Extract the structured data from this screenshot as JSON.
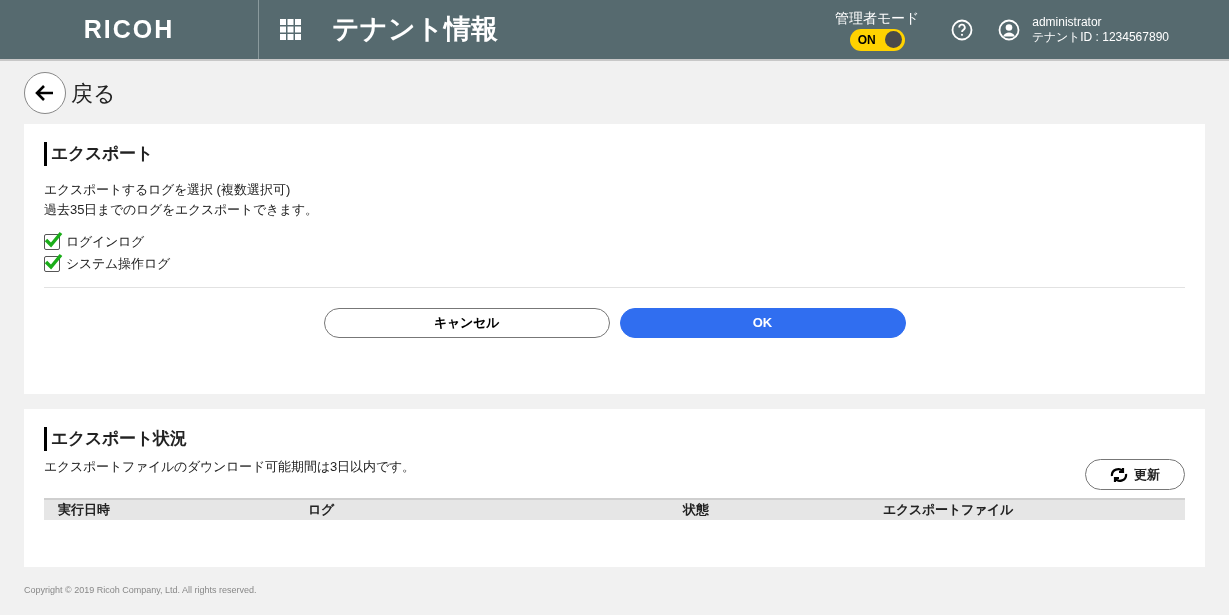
{
  "header": {
    "logo": "RICOH",
    "title": "テナント情報",
    "admin_mode": {
      "label": "管理者モード",
      "toggle_text": "ON",
      "on": true
    },
    "user": {
      "name": "administrator",
      "tenant_id": "テナントID : 1234567890"
    }
  },
  "back": {
    "label": "戻る"
  },
  "export": {
    "title": "エクスポート",
    "description": [
      "エクスポートするログを選択 (複数選択可)",
      "過去35日までのログをエクスポートできます。"
    ],
    "options": [
      {
        "label": "ログインログ",
        "checked": true
      },
      {
        "label": "システム操作ログ",
        "checked": true
      }
    ],
    "buttons": [
      {
        "label": "キャンセル",
        "kind": "secondary"
      },
      {
        "label": "OK",
        "kind": "primary"
      }
    ]
  },
  "status": {
    "title": "エクスポート状況",
    "note": "エクスポートファイルのダウンロード可能期間は3日以内です。",
    "refresh": "更新",
    "table": {
      "columns": [
        "実行日時",
        "ログ",
        "状態",
        "エクスポートファイル"
      ]
    }
  },
  "footer": "Copyright © 2019 Ricoh Company, Ltd. All rights reserved."
}
